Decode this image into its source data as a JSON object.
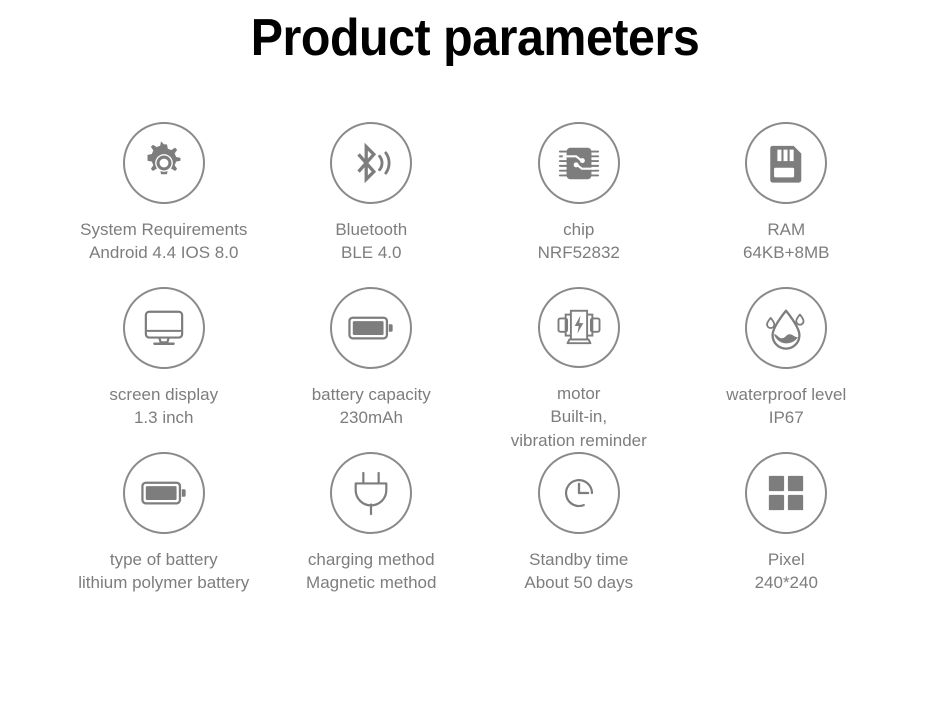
{
  "title": "Product parameters",
  "theme": {
    "title_color": "#000000",
    "icon_color": "#7d7d7d",
    "circle_border_color": "#8a8a8a",
    "label_color": "#7d7d7d",
    "background": "#ffffff"
  },
  "items": [
    {
      "icon": "gear-icon",
      "lines": [
        "System Requirements",
        "Android 4.4 IOS 8.0"
      ]
    },
    {
      "icon": "bluetooth-icon",
      "lines": [
        "Bluetooth",
        "BLE 4.0"
      ]
    },
    {
      "icon": "chip-icon",
      "lines": [
        "chip",
        "NRF52832"
      ]
    },
    {
      "icon": "memory-card-icon",
      "lines": [
        "RAM",
        "64KB+8MB"
      ]
    },
    {
      "icon": "monitor-icon",
      "lines": [
        "screen display",
        "1.3 inch"
      ]
    },
    {
      "icon": "battery-icon",
      "lines": [
        "battery capacity",
        "230mAh"
      ]
    },
    {
      "icon": "motor-icon",
      "lines": [
        "motor",
        "Built-in,",
        "vibration reminder"
      ]
    },
    {
      "icon": "water-drop-icon",
      "lines": [
        "waterproof level",
        "IP67"
      ]
    },
    {
      "icon": "battery-icon",
      "lines": [
        "type of battery",
        "lithium polymer battery"
      ]
    },
    {
      "icon": "power-plug-icon",
      "lines": [
        "charging method",
        "Magnetic method"
      ]
    },
    {
      "icon": "clock-icon",
      "lines": [
        "Standby time",
        "About 50 days"
      ]
    },
    {
      "icon": "pixel-grid-icon",
      "lines": [
        "Pixel",
        "240*240"
      ]
    }
  ]
}
